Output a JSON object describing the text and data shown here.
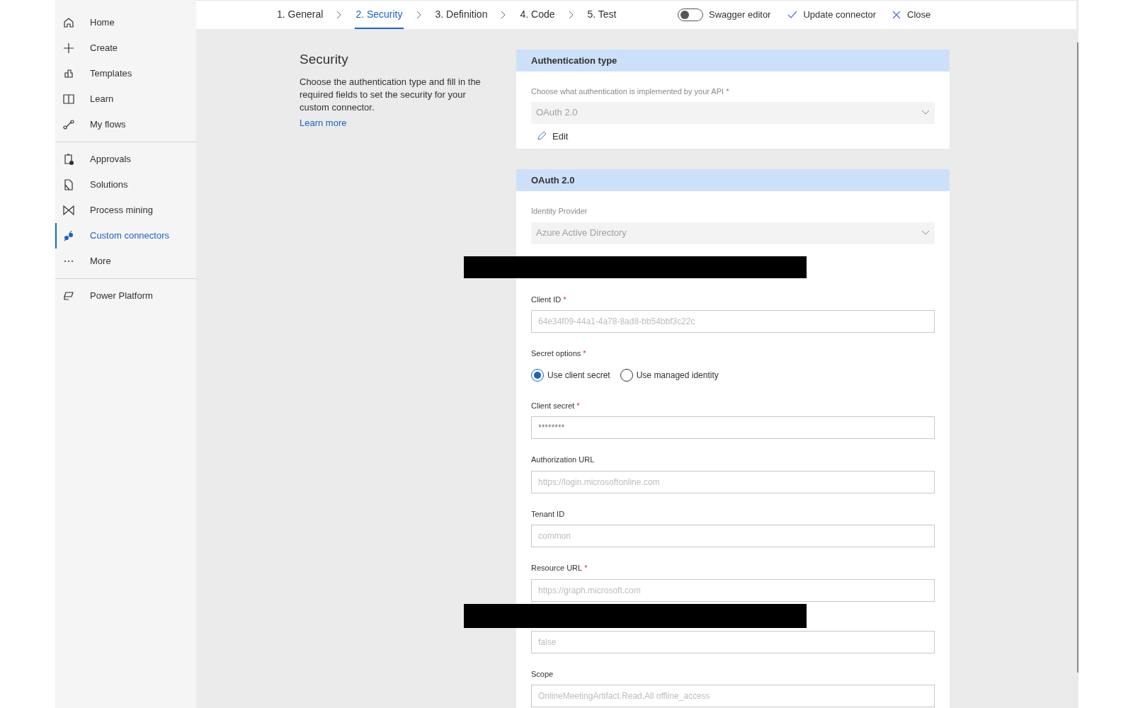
{
  "sidebar": {
    "groups": [
      [
        {
          "label": "Home",
          "selected": false
        },
        {
          "label": "Create",
          "selected": false
        },
        {
          "label": "Templates",
          "selected": false
        },
        {
          "label": "Learn",
          "selected": false
        },
        {
          "label": "My flows",
          "selected": false
        }
      ],
      [
        {
          "label": "Approvals",
          "selected": false
        },
        {
          "label": "Solutions",
          "selected": false
        },
        {
          "label": "Process mining",
          "selected": false
        },
        {
          "label": "Custom connectors",
          "selected": true
        },
        {
          "label": "More",
          "selected": false
        }
      ],
      [
        {
          "label": "Power Platform",
          "selected": false
        }
      ]
    ]
  },
  "steps": [
    {
      "label": "1. General",
      "selected": false
    },
    {
      "label": "2. Security",
      "selected": true
    },
    {
      "label": "3. Definition",
      "selected": false
    },
    {
      "label": "4. Code",
      "selected": false
    },
    {
      "label": "5. Test",
      "selected": false
    }
  ],
  "toolbar": {
    "swagger_toggle": {
      "label": "Swagger editor",
      "on": false
    },
    "actions": [
      {
        "kind": "check",
        "label": "Update connector"
      },
      {
        "kind": "close",
        "label": "Close"
      }
    ]
  },
  "intro": {
    "title": "Security",
    "text": "Choose the authentication type and fill in the required fields to set the security for your custom connector.",
    "link": "Learn more"
  },
  "auth_card": {
    "title": "Authentication type",
    "field": {
      "label": "Choose what authentication is implemented by your API *",
      "value": "OAuth 2.0",
      "disabled": true
    },
    "edit": "Edit"
  },
  "oauth_card": {
    "title": "OAuth 2.0",
    "fields": [
      {
        "kind": "dropdown",
        "label": "Identity Provider",
        "value": "Azure Active Directory",
        "disabled": true
      },
      {
        "kind": "text",
        "label": "Client ID",
        "required_mark": "*",
        "placeholder": "64e34f09-44a1-4a78-8ad8-bb54bbf3c22c"
      },
      {
        "kind": "radio",
        "label": "Secret options",
        "required_mark": "*",
        "options": [
          {
            "label": "Use client secret",
            "selected": true
          },
          {
            "label": "Use managed identity",
            "selected": false
          }
        ]
      },
      {
        "kind": "text",
        "label": "Client secret",
        "required_mark": "*",
        "value": "********"
      },
      {
        "kind": "text",
        "label": "Authorization URL",
        "placeholder": "https://login.microsoftonline.com"
      },
      {
        "kind": "text",
        "label": "Tenant ID",
        "placeholder": "common"
      },
      {
        "kind": "text",
        "label": "Resource URL",
        "required_mark": "*",
        "placeholder": "https://graph.microsoft.com"
      },
      {
        "kind": "text",
        "placeholder": "false"
      },
      {
        "kind": "text",
        "label": "Scope",
        "placeholder": "OnlineMeetingArtifact.Read.All offline_access"
      }
    ]
  }
}
